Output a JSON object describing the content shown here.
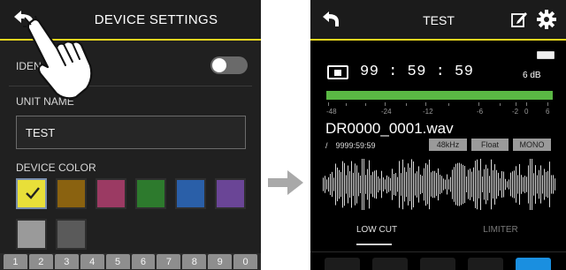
{
  "left_screen": {
    "title": "DEVICE SETTINGS",
    "identify_label": "IDEN",
    "identify_toggle_on": false,
    "unit_name_label": "UNIT NAME",
    "unit_name_value": "TEST",
    "device_color_label": "DEVICE COLOR",
    "colors": [
      "#e8df39",
      "#8a6210",
      "#9b3a63",
      "#2d7a2d",
      "#2a5fa8",
      "#6a4596",
      "#9a9a9a",
      "#5a5a5a"
    ],
    "selected_color_index": 0,
    "keys": [
      "1",
      "2",
      "3",
      "4",
      "5",
      "6",
      "7",
      "8",
      "9",
      "0"
    ]
  },
  "right_screen": {
    "title": "TEST",
    "time": "99 : 59 : 59",
    "db": "6 dB",
    "scale": [
      "-48",
      "-24",
      "-12",
      "-6",
      "-2",
      "0",
      "6"
    ],
    "filename": "DR0000_0001.wav",
    "remaining": "/ 9999:59:59",
    "badges": [
      "48kHz",
      "Float",
      "MONO"
    ],
    "tabs": [
      "LOW CUT",
      "LIMITER"
    ],
    "meter_level": 1.0
  }
}
